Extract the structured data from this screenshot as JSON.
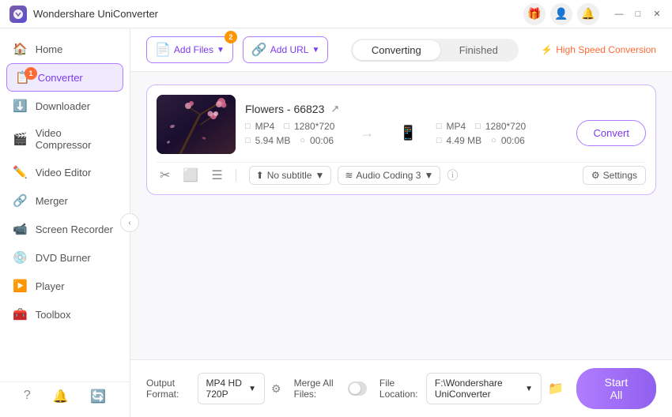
{
  "app": {
    "title": "Wondershare UniConverter",
    "logo_color": "#7b5ea7"
  },
  "titlebar": {
    "icons": [
      "gift-icon",
      "user-icon",
      "bell-icon",
      "minimize-icon",
      "maximize-icon",
      "close-icon"
    ],
    "minimize": "—",
    "maximize": "□",
    "close": "✕"
  },
  "sidebar": {
    "items": [
      {
        "id": "home",
        "label": "Home",
        "icon": "🏠"
      },
      {
        "id": "converter",
        "label": "Converter",
        "icon": "📋",
        "active": true,
        "badge": "1"
      },
      {
        "id": "downloader",
        "label": "Downloader",
        "icon": "⬇️"
      },
      {
        "id": "video-compressor",
        "label": "Video Compressor",
        "icon": "🎬"
      },
      {
        "id": "video-editor",
        "label": "Video Editor",
        "icon": "✂️"
      },
      {
        "id": "merger",
        "label": "Merger",
        "icon": "🔗"
      },
      {
        "id": "screen-recorder",
        "label": "Screen Recorder",
        "icon": "📹"
      },
      {
        "id": "dvd-burner",
        "label": "DVD Burner",
        "icon": "💿"
      },
      {
        "id": "player",
        "label": "Player",
        "icon": "▶️"
      },
      {
        "id": "toolbox",
        "label": "Toolbox",
        "icon": "🧰"
      }
    ],
    "bottom_icons": [
      "?",
      "🔔",
      "🔄"
    ]
  },
  "toolbar": {
    "add_files_label": "Add Files",
    "add_files_badge": "2",
    "add_url_label": "Add URL",
    "tabs": [
      "Converting",
      "Finished"
    ],
    "active_tab": "Converting",
    "high_speed_label": "High Speed Conversion"
  },
  "file_card": {
    "filename": "Flowers - 66823",
    "source": {
      "format": "MP4",
      "resolution": "1280*720",
      "size": "5.94 MB",
      "duration": "00:06"
    },
    "target": {
      "format": "MP4",
      "resolution": "1280*720",
      "size": "4.49 MB",
      "duration": "00:06"
    },
    "convert_btn_label": "Convert",
    "subtitle_label": "No subtitle",
    "audio_label": "Audio Coding 3",
    "settings_label": "Settings"
  },
  "bottom_bar": {
    "output_format_label": "Output Format:",
    "output_format_value": "MP4 HD 720P",
    "file_location_label": "File Location:",
    "file_location_value": "F:\\Wondershare UniConverter",
    "merge_label": "Merge All Files:",
    "start_all_label": "Start All",
    "location_icon": "📁"
  }
}
